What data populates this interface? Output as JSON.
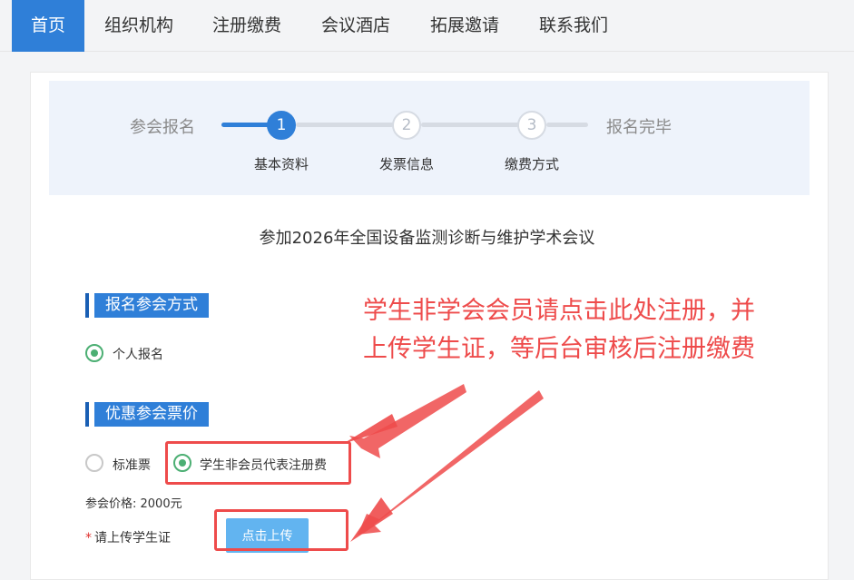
{
  "nav": {
    "items": [
      {
        "label": "首页",
        "active": true
      },
      {
        "label": "组织机构",
        "active": false
      },
      {
        "label": "注册缴费",
        "active": false
      },
      {
        "label": "会议酒店",
        "active": false
      },
      {
        "label": "拓展邀请",
        "active": false
      },
      {
        "label": "联系我们",
        "active": false
      }
    ]
  },
  "steps": {
    "start_label": "参会报名",
    "end_label": "报名完毕",
    "items": [
      {
        "number": "1",
        "label": "基本资料",
        "active": true
      },
      {
        "number": "2",
        "label": "发票信息",
        "active": false
      },
      {
        "number": "3",
        "label": "缴费方式",
        "active": false
      }
    ]
  },
  "conference_title": "参加2026年全国设备监测诊断与维护学术会议",
  "section_mode": {
    "title": "报名参会方式",
    "option": {
      "label": "个人报名",
      "checked": true
    }
  },
  "section_ticket": {
    "title": "优惠参会票价",
    "options": [
      {
        "label": "标准票",
        "checked": false
      },
      {
        "label": "学生非会员代表注册费",
        "checked": true
      }
    ]
  },
  "price_text": "参会价格: 2000元",
  "upload": {
    "required_mark": "*",
    "label": "请上传学生证",
    "button_label": "点击上传"
  },
  "annotation": {
    "line1": "学生非学会会员请点击此处注册，并",
    "line2": "上传学生证，等后台审核后注册缴费"
  },
  "colors": {
    "primary": "#2f7fd8",
    "annotation_red": "#ee4b4b",
    "radio_green": "#4caf73",
    "upload_button": "#62b4f0"
  }
}
